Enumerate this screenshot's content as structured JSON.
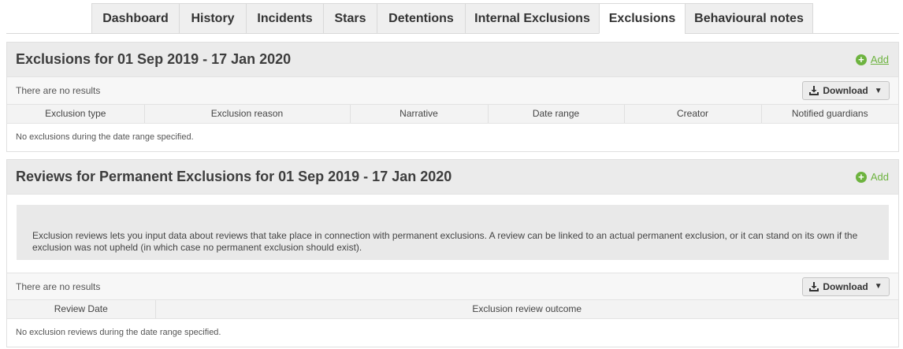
{
  "tabs": [
    {
      "label": "Dashboard",
      "active": false
    },
    {
      "label": "History",
      "active": false
    },
    {
      "label": "Incidents",
      "active": false
    },
    {
      "label": "Stars",
      "active": false
    },
    {
      "label": "Detentions",
      "active": false
    },
    {
      "label": "Internal Exclusions",
      "active": false
    },
    {
      "label": "Exclusions",
      "active": true
    },
    {
      "label": "Behavioural notes",
      "active": false
    }
  ],
  "exclusions": {
    "title": "Exclusions for 01 Sep 2019 - 17 Jan 2020",
    "add_label": "Add",
    "results_text": "There are no results",
    "download_label": "Download",
    "columns": [
      "Exclusion type",
      "Exclusion reason",
      "Narrative",
      "Date range",
      "Creator",
      "Notified guardians"
    ],
    "empty_text": "No exclusions during the date range specified."
  },
  "reviews": {
    "title": "Reviews for Permanent Exclusions for 01 Sep 2019 - 17 Jan 2020",
    "add_label": "Add",
    "info_text": "Exclusion reviews lets you input data about reviews that take place in connection with permanent exclusions. A review can be linked to an actual permanent exclusion, or it can stand on its own if the exclusion was not upheld (in which case no permanent exclusion should exist).",
    "results_text": "There are no results",
    "download_label": "Download",
    "columns": [
      "Review Date",
      "Exclusion review outcome"
    ],
    "empty_text": "No exclusion reviews during the date range specified."
  },
  "colors": {
    "accent": "#6db33f",
    "header_bg": "#ebebeb"
  },
  "icons": [
    "plus-circle-icon",
    "download-icon",
    "caret-down-icon"
  ]
}
